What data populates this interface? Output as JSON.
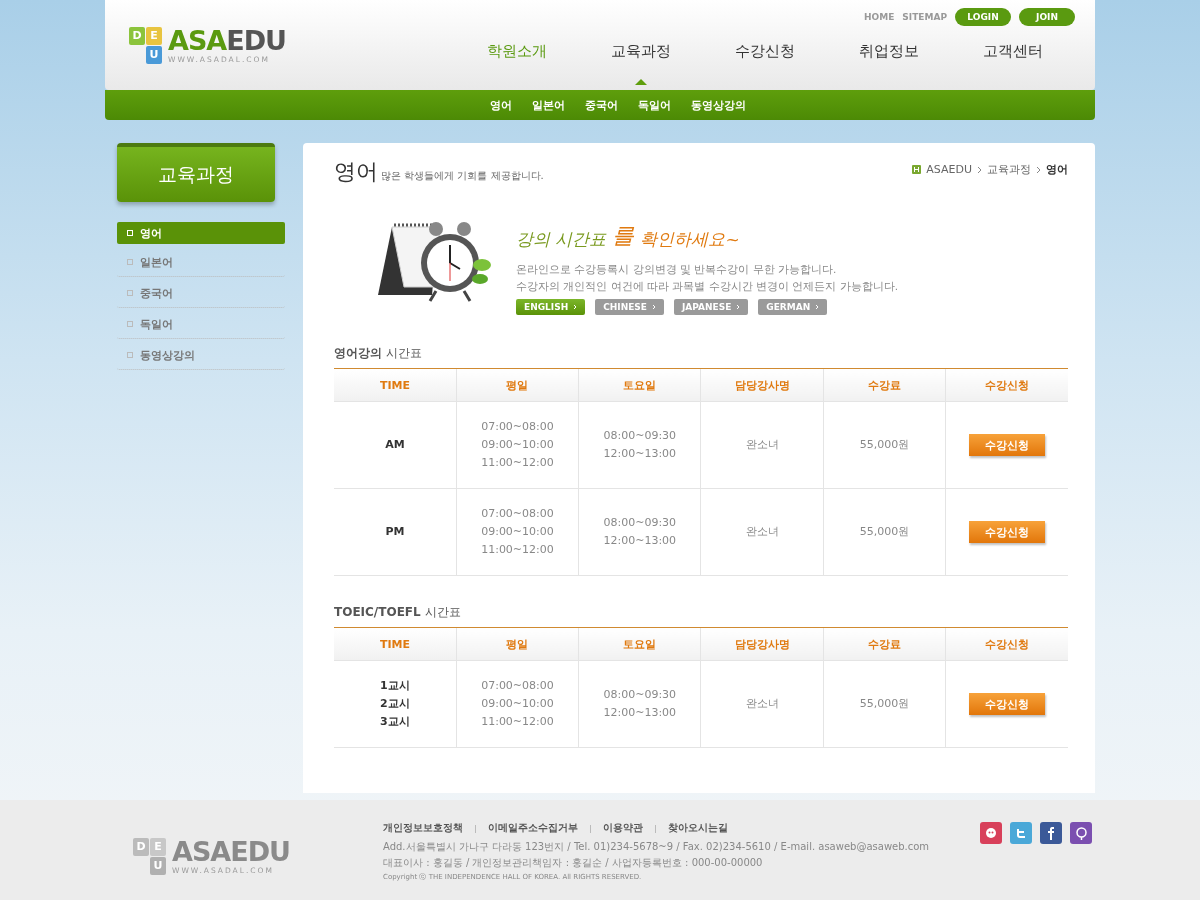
{
  "header": {
    "logo": {
      "blocks": [
        "D",
        "E",
        "U"
      ],
      "name_parts": [
        "ASA",
        "EDU"
      ],
      "url": "WWW.ASADAL.COM"
    },
    "util_links": [
      "HOME",
      "SITEMAP"
    ],
    "auth_buttons": [
      "LOGIN",
      "JOIN"
    ],
    "nav": [
      {
        "label": "학원소개",
        "selected": false,
        "hover": true
      },
      {
        "label": "교육과정",
        "selected": true,
        "hover": false
      },
      {
        "label": "수강신청",
        "selected": false,
        "hover": false
      },
      {
        "label": "취업정보",
        "selected": false,
        "hover": false
      },
      {
        "label": "고객센터",
        "selected": false,
        "hover": false
      }
    ],
    "subnav": [
      "영어",
      "일본어",
      "중국어",
      "독일어",
      "동영상강의"
    ]
  },
  "sidebar": {
    "title": "교육과정",
    "items": [
      {
        "label": "영어",
        "selected": true
      },
      {
        "label": "일본어",
        "selected": false
      },
      {
        "label": "중국어",
        "selected": false
      },
      {
        "label": "독일어",
        "selected": false
      },
      {
        "label": "동영상강의",
        "selected": false
      }
    ]
  },
  "content": {
    "title": "영어",
    "subtitle": "많은 학생들에게 기회를 제공합니다.",
    "breadcrumb": [
      {
        "label": "ASAEDU",
        "current": false
      },
      {
        "label": "교육과정",
        "current": false
      },
      {
        "label": "영어",
        "current": true
      }
    ],
    "banner": {
      "headline": [
        {
          "text": "강의 시간표",
          "kind": "green"
        },
        {
          "text": "를",
          "kind": "big"
        },
        {
          "text": "확인하세요~",
          "kind": "orange"
        }
      ],
      "lines": [
        "온라인으로 수강등록시 강의변경 및 반복수강이 무한 가능합니다.",
        "수강자의 개인적인 여건에 따라 과목별 수강시간 변경이 언제든지 가능합니다."
      ],
      "tabs": [
        {
          "label": "ENGLISH",
          "selected": true
        },
        {
          "label": "CHINESE",
          "selected": false
        },
        {
          "label": "JAPANESE",
          "selected": false
        },
        {
          "label": "GERMAN",
          "selected": false
        }
      ]
    },
    "tables": [
      {
        "title_bold": "영어강의",
        "title_rest": "시간표",
        "columns": [
          "TIME",
          "평일",
          "토요일",
          "담당강사명",
          "수강료",
          "수강신청"
        ],
        "rows": [
          {
            "time": [
              "AM"
            ],
            "weekday": [
              "07:00~08:00",
              "09:00~10:00",
              "11:00~12:00"
            ],
            "saturday": [
              "08:00~09:30",
              "12:00~13:00"
            ],
            "teacher": "완소녀",
            "fee": "55,000원",
            "button": "수강신청"
          },
          {
            "time": [
              "PM"
            ],
            "weekday": [
              "07:00~08:00",
              "09:00~10:00",
              "11:00~12:00"
            ],
            "saturday": [
              "08:00~09:30",
              "12:00~13:00"
            ],
            "teacher": "완소녀",
            "fee": "55,000원",
            "button": "수강신청"
          }
        ]
      },
      {
        "title_bold": "TOEIC/TOEFL",
        "title_rest": "시간표",
        "columns": [
          "TIME",
          "평일",
          "토요일",
          "담당강사명",
          "수강료",
          "수강신청"
        ],
        "rows": [
          {
            "time": [
              "1교시",
              "2교시",
              "3교시"
            ],
            "weekday": [
              "07:00~08:00",
              "09:00~10:00",
              "11:00~12:00"
            ],
            "saturday": [
              "08:00~09:30",
              "12:00~13:00"
            ],
            "teacher": "완소녀",
            "fee": "55,000원",
            "button": "수강신청"
          }
        ]
      }
    ]
  },
  "footer": {
    "logo": {
      "blocks": [
        "D",
        "E",
        "U"
      ],
      "name": "ASAEDU",
      "url": "WWW.ASADAL.COM"
    },
    "links": [
      "개인정보보호정책",
      "이메일주소수집거부",
      "이용약관",
      "찾아오시는길"
    ],
    "address": "Add.서울특별시 가나구 다라동 123번지  / Tel. 01)234-5678~9  / Fax. 02)234-5610  / E-mail. asaweb@asaweb.com",
    "info": "대표이사 : 홍길동 / 개인정보관리책임자 : 홍길순 / 사업자등록번호 : 000-00-00000",
    "copyright": "Copyright ⓒ THE INDEPENDENCE HALL OF KOREA. All RIGHTS RESERVED.",
    "social": [
      {
        "kind": "face",
        "color": "#d8405a"
      },
      {
        "kind": "bird",
        "color": "#4aa8d8"
      },
      {
        "kind": "f",
        "color": "#3b5998"
      },
      {
        "kind": "bubble",
        "color": "#7b4fb0"
      }
    ]
  }
}
